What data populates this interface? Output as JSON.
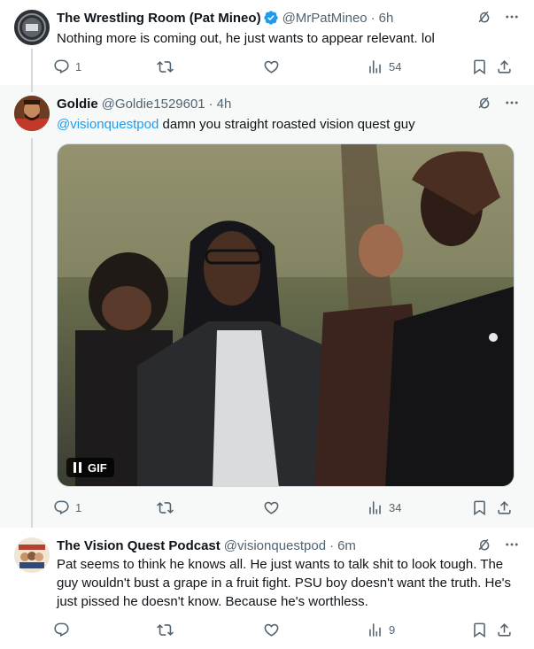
{
  "tweets": [
    {
      "name": "The Wrestling Room (Pat Mineo)",
      "handle": "@MrPatMineo",
      "dot": "·",
      "time": "6h",
      "text": "Nothing more is coming out, he just wants to appear relevant. lol",
      "replies": "1",
      "views": "54",
      "verified": true
    },
    {
      "name": "Goldie",
      "handle": "@Goldie1529601",
      "dot": "·",
      "time": "4h",
      "mention": "@visionquestpod",
      "text": " damn you straight roasted vision quest guy",
      "replies": "1",
      "views": "34",
      "media": {
        "badge": "GIF",
        "type": "gif"
      }
    },
    {
      "name": "The Vision Quest Podcast",
      "handle": "@visionquestpod",
      "dot": "·",
      "time": "6m",
      "text": "Pat seems to think he knows all. He just wants to talk shit to look tough. The guy wouldn't bust a grape in a fruit fight. PSU boy doesn't want the truth. He's just pissed he doesn't know. Because he's worthless.",
      "replies": "",
      "views": "9"
    }
  ],
  "colors": {
    "accent": "#1d9bf0",
    "secondary": "#536471",
    "highlight": "#f7f9f9",
    "line": "#cfd9de"
  },
  "icons": [
    "grok-icon",
    "more-icon",
    "reply-icon",
    "retweet-icon",
    "like-icon",
    "views-icon",
    "bookmark-icon",
    "share-icon",
    "verified-icon",
    "pause-icon"
  ]
}
